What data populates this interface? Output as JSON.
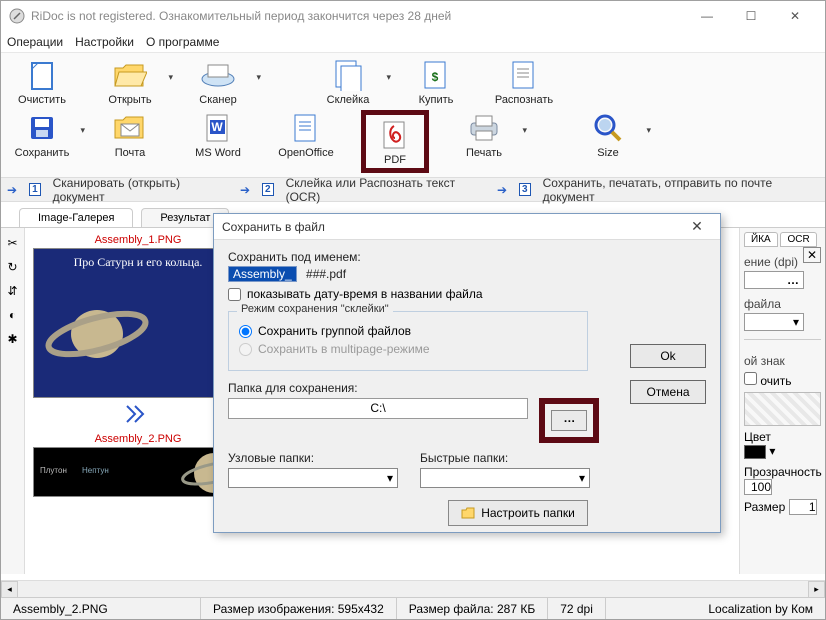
{
  "window": {
    "title": "RiDoc is not registered. Ознакомительный период закончится через 28 дней"
  },
  "menu": {
    "items": [
      "Операции",
      "Настройки",
      "О программе"
    ]
  },
  "toolbar": {
    "row1": [
      "Очистить",
      "Открыть",
      "Сканер",
      "Склейка",
      "Купить",
      "Распознать"
    ],
    "row2": [
      "Сохранить",
      "Почта",
      "MS Word",
      "OpenOffice",
      "PDF",
      "Печать",
      "Size"
    ]
  },
  "steps": {
    "s1": "Сканировать (открыть) документ",
    "s2": "Склейка или Распознать текст (OCR)",
    "s3": "Сохранить, печатать, отправить по почте документ"
  },
  "tabs": {
    "gallery": "Image-Галерея",
    "result": "Результат"
  },
  "gallery": {
    "thumb1": "Assembly_1.PNG",
    "thumb2": "Assembly_2.PNG",
    "saturn_title": "Про Сатурн и его кольца."
  },
  "rightpanel": {
    "tab1": "ЙКА",
    "tab2": "OCR",
    "dpi_label": "ение (dpi)",
    "file_label": "файла",
    "stamp_label": "ой знак",
    "include_label": "очить",
    "color_label": "Цвет",
    "opacity_label": "Прозрачность",
    "opacity_val": "100",
    "size_label": "Размер",
    "size_val": "1"
  },
  "dialog": {
    "title": "Сохранить в файл",
    "name_label": "Сохранить под именем:",
    "name_value": "Assembly_",
    "ext": "###.pdf",
    "chk_date": "показывать дату-время в названии файла",
    "group_label": "Режим сохранения \"склейки\"",
    "opt1": "Сохранить группой файлов",
    "opt2": "Сохранить в multipage-режиме",
    "ok": "Ok",
    "cancel": "Отмена",
    "folder_label": "Папка для сохранения:",
    "folder_value": "C:\\",
    "nodes_label": "Узловые папки:",
    "fast_label": "Быстрые папки:",
    "cfg": "Настроить папки"
  },
  "status": {
    "file": "Assembly_2.PNG",
    "imgsize": "Размер изображения: 595x432",
    "filesize": "Размер файла: 287 КБ",
    "dpi": "72 dpi",
    "loc": "Localization by Ком"
  }
}
